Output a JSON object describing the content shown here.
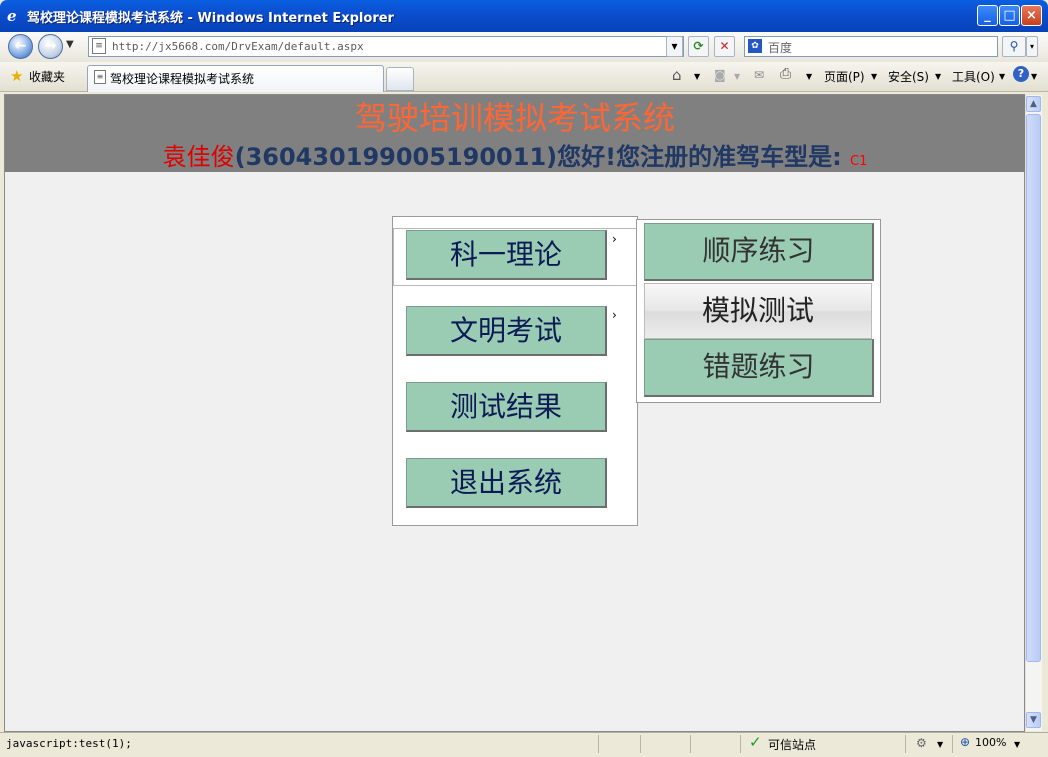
{
  "window": {
    "title": "驾校理论课程模拟考试系统 - Windows Internet Explorer",
    "controls": {
      "minimize": "_",
      "maximize": "□",
      "close": "×"
    }
  },
  "address_bar": {
    "url": "http://jx5668.com/DrvExam/default.aspx",
    "search_placeholder": "百度"
  },
  "tab_bar": {
    "favorites_label": "收藏夹",
    "active_tab_title": "驾校理论课程模拟考试系统",
    "commands": {
      "page": "页面(P)",
      "safety": "安全(S)",
      "tools": "工具(O)"
    }
  },
  "page": {
    "system_title": "驾驶培训模拟考试系统",
    "user_name": "袁佳俊",
    "user_id": "(360430199005190011)",
    "greeting_text": "您好!您注册的准驾车型是:",
    "car_type": "C1"
  },
  "menu": {
    "items": [
      {
        "label": "科一理论",
        "has_submenu": true
      },
      {
        "label": "文明考试",
        "has_submenu": true
      },
      {
        "label": "测试结果",
        "has_submenu": false
      },
      {
        "label": "退出系统",
        "has_submenu": false
      }
    ],
    "arrow": "›"
  },
  "submenu": {
    "items": [
      {
        "label": "顺序练习"
      },
      {
        "label": "模拟测试"
      },
      {
        "label": "错题练习"
      }
    ]
  },
  "status_bar": {
    "text": "javascript:test(1);",
    "zone": "可信站点",
    "zoom": "100%"
  },
  "colors": {
    "title_text": "#FF6633",
    "header_band": "#808080",
    "menu_button": "#99CCB3",
    "user_name": "#E00000",
    "greeting": "#1F3864"
  }
}
